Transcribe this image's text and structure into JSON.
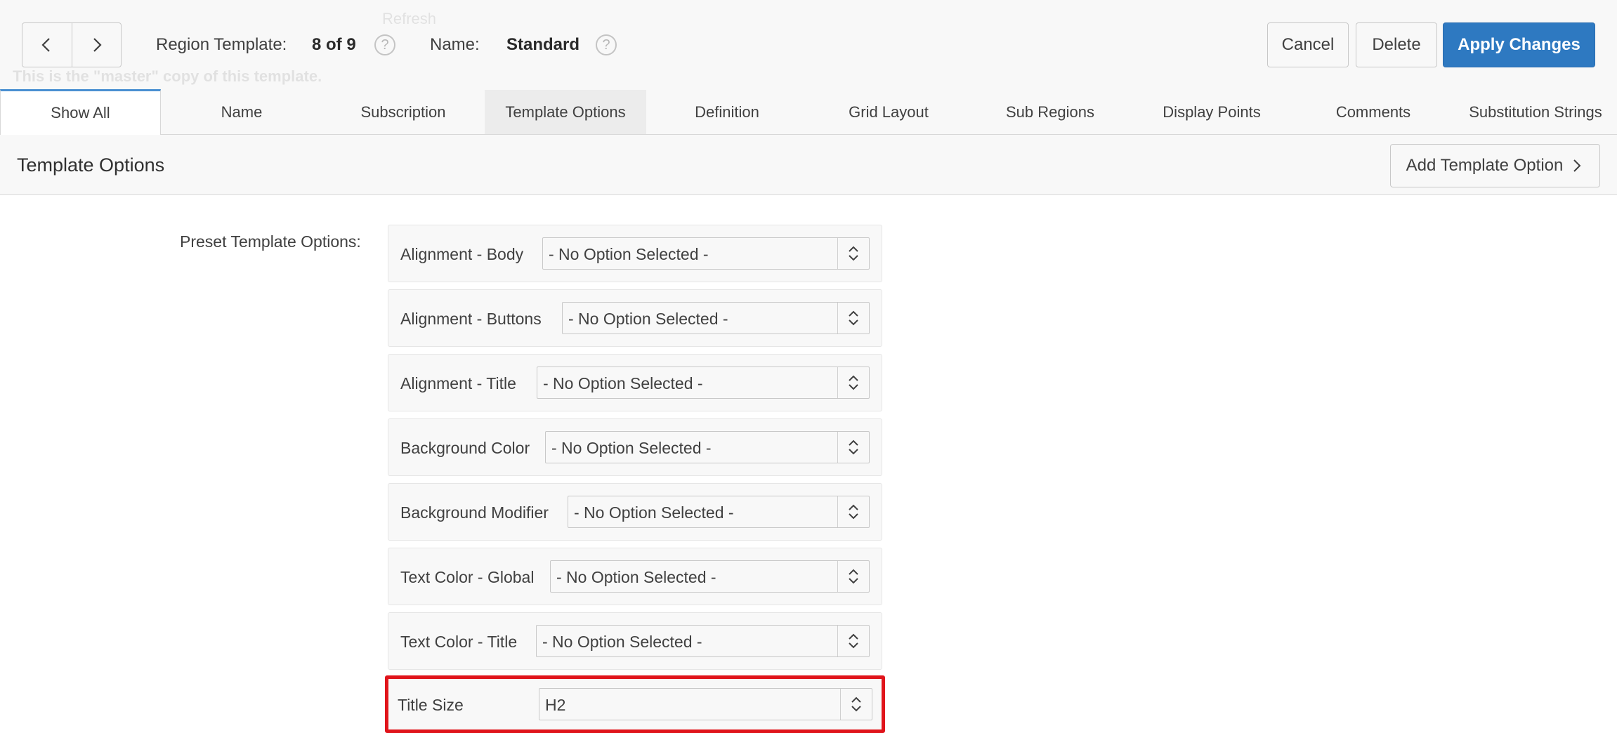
{
  "header": {
    "prev_label": "Previous",
    "next_label": "Next",
    "region_template_label": "Region Template:",
    "region_template_position": "8 of 9",
    "name_label": "Name:",
    "name_value": "Standard",
    "help_glyph": "?",
    "background_text": {
      "refresh": "Refresh",
      "master_note": "This is the \"master\" copy of this template."
    }
  },
  "buttons": {
    "cancel": "Cancel",
    "delete": "Delete",
    "apply": "Apply Changes"
  },
  "tabs": [
    {
      "label": "Show All",
      "selected": true
    },
    {
      "label": "Name"
    },
    {
      "label": "Subscription"
    },
    {
      "label": "Template Options",
      "highlighted": true
    },
    {
      "label": "Definition"
    },
    {
      "label": "Grid Layout"
    },
    {
      "label": "Sub Regions"
    },
    {
      "label": "Display Points"
    },
    {
      "label": "Comments"
    },
    {
      "label": "Substitution Strings"
    }
  ],
  "region": {
    "title": "Template Options",
    "add_button": "Add Template Option"
  },
  "form": {
    "preset_label": "Preset Template Options:",
    "options": [
      {
        "label": "Alignment - Body",
        "value": "- No Option Selected -"
      },
      {
        "label": "Alignment - Buttons",
        "value": "- No Option Selected -"
      },
      {
        "label": "Alignment - Title",
        "value": "- No Option Selected -"
      },
      {
        "label": "Background Color",
        "value": "- No Option Selected -"
      },
      {
        "label": "Background Modifier",
        "value": "- No Option Selected -"
      },
      {
        "label": "Text Color - Global",
        "value": "- No Option Selected -"
      },
      {
        "label": "Text Color - Title",
        "value": "- No Option Selected -"
      },
      {
        "label": "Title Size",
        "value": "H2",
        "highlighted": true
      }
    ]
  },
  "colors": {
    "primary": "#2e79c1",
    "highlight_border": "#e0141b",
    "tab_accent": "#4a8fd1"
  }
}
